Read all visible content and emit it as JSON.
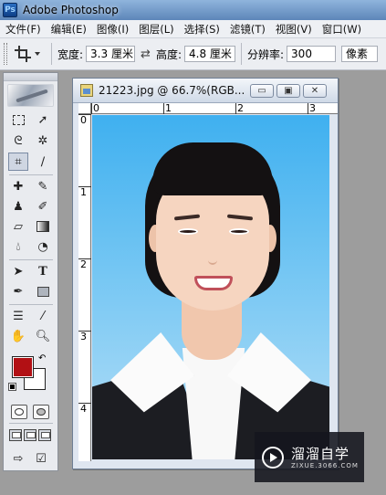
{
  "app": {
    "title": "Adobe Photoshop",
    "icon_letters": "Ps"
  },
  "menu": [
    "文件(F)",
    "编辑(E)",
    "图像(I)",
    "图层(L)",
    "选择(S)",
    "滤镜(T)",
    "视图(V)",
    "窗口(W)"
  ],
  "options": {
    "width_label": "宽度:",
    "width_value": "3.3 厘米",
    "swap_glyph": "⇄",
    "height_label": "高度:",
    "height_value": "4.8 厘米",
    "resolution_label": "分辨率:",
    "resolution_value": "300",
    "resolution_unit": "像素"
  },
  "toolbox": {
    "active_tool": "crop-tool",
    "foreground_color": "#b21014",
    "background_color": "#ffffff"
  },
  "document": {
    "title": "21223.jpg @ 66.7%(RGB...",
    "minimize": "▭",
    "maximize": "▣",
    "close": "✕",
    "ruler_top": [
      "0",
      "1",
      "2",
      "3"
    ],
    "ruler_left": [
      "0",
      "1",
      "2",
      "3",
      "4"
    ],
    "background_color": "#74c6f3"
  },
  "watermark": {
    "main": "溜溜自学",
    "sub": "ZIXUE.3066.COM"
  }
}
